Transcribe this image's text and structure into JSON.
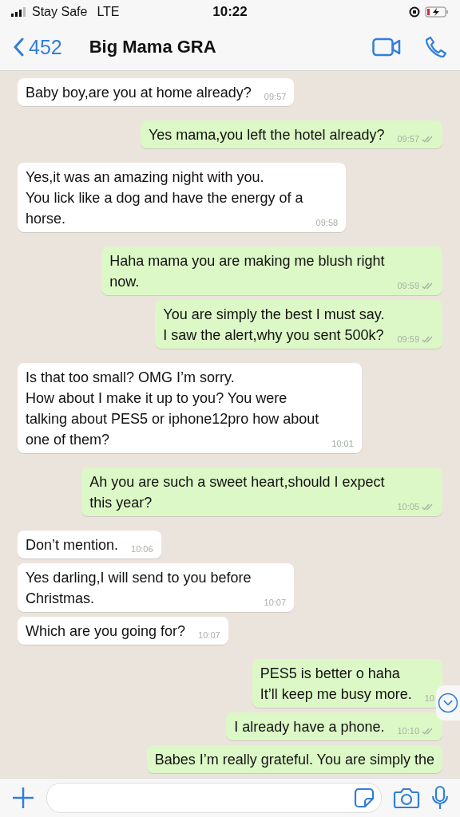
{
  "status_bar": {
    "carrier": "Stay Safe",
    "network": "LTE",
    "time": "10:22"
  },
  "header": {
    "back_count": "452",
    "contact_name": "Big Mama GRA"
  },
  "messages": [
    {
      "outgoing": false,
      "text": "Baby boy,are you at home already?",
      "time": "09:57"
    },
    {
      "outgoing": true,
      "text": "Yes mama,you left the hotel already?",
      "time": "09:57",
      "read": true
    },
    {
      "outgoing": false,
      "text": "Yes,it was an amazing night with you.\nYou lick like a dog and have the energy of a\nhorse.",
      "time": "09:58"
    },
    {
      "outgoing": true,
      "text": "Haha mama you are making me blush right\nnow.",
      "time": "09:59",
      "read": true
    },
    {
      "outgoing": true,
      "text": "You are simply the best I must say.\nI saw the alert,why you sent 500k?",
      "time": "09:59",
      "read": true
    },
    {
      "outgoing": false,
      "text": "Is that too small? OMG I’m sorry.\nHow about I make it up to you? You were\ntalking about PES5 or iphone12pro how about\none of them?",
      "time": "10:01"
    },
    {
      "outgoing": true,
      "text": "Ah you are such a sweet heart,should I expect\nthis year?",
      "time": "10:05",
      "read": true
    },
    {
      "outgoing": false,
      "text": "Don’t mention.",
      "time": "10:06"
    },
    {
      "outgoing": false,
      "text": "Yes darling,I will send to you before\nChristmas.",
      "time": "10:07"
    },
    {
      "outgoing": false,
      "text": "Which are you going for?",
      "time": "10:07"
    },
    {
      "outgoing": true,
      "text": "PES5 is better o haha\nIt’ll keep me busy more.",
      "time": "10"
    },
    {
      "outgoing": true,
      "text": "I already have a phone.",
      "time": "10:10",
      "read": true
    },
    {
      "outgoing": true,
      "text": "Babes I’m really grateful. You are simply the"
    }
  ]
}
